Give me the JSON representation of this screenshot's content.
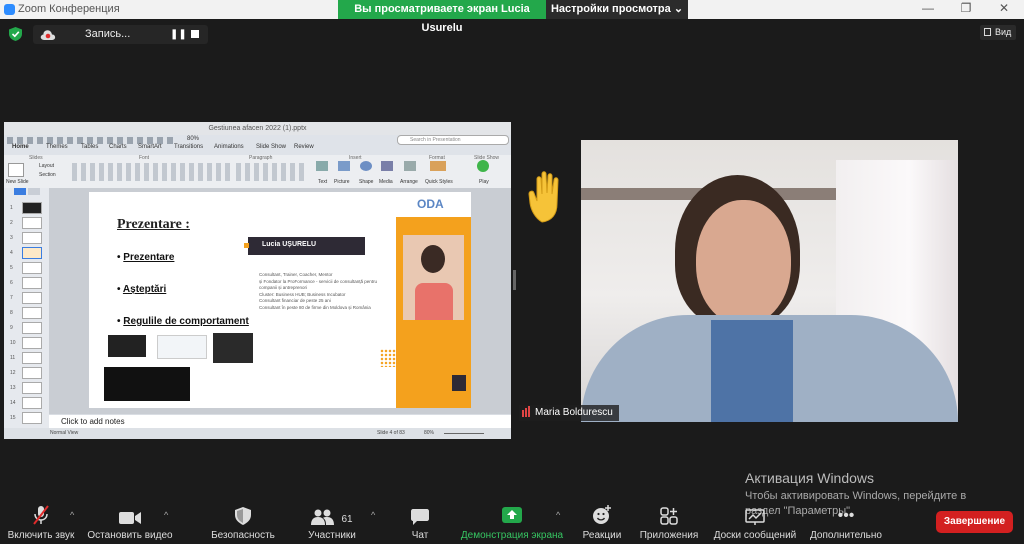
{
  "window": {
    "title": "Zoom Конференция"
  },
  "banner": {
    "sharing": "Вы просматриваете экран Lucia Usurelu",
    "view_options": "Настройки просмотра"
  },
  "recording": {
    "label": "Запись..."
  },
  "view_button": {
    "label": "Вид"
  },
  "presentation": {
    "file_title": "Gestiunea afacen 2022 (1).pptx",
    "search_placeholder": "Search in Presentation",
    "zoom_level": "80%",
    "tabs": [
      "Home",
      "Themes",
      "Tables",
      "Charts",
      "SmartArt",
      "Transitions",
      "Animations",
      "Slide Show",
      "Review"
    ],
    "ribbon_groups": [
      "Slides",
      "Font",
      "Paragraph",
      "Insert",
      "Format",
      "Slide Show"
    ],
    "ribbon_labels": [
      "New Slide",
      "Layout",
      "Section",
      "Text",
      "Picture",
      "Shape",
      "Media",
      "Arrange",
      "Quick Styles",
      "Play"
    ],
    "notes_placeholder": "Click to add notes",
    "status_view": "Normal View",
    "slide_counter": "Slide 4 of 83",
    "status_zoom": "80%",
    "slide_numbers": [
      "1",
      "2",
      "3",
      "4",
      "5",
      "6",
      "7",
      "8",
      "9",
      "10",
      "11",
      "12",
      "13",
      "14",
      "15",
      "16"
    ],
    "slide": {
      "heading": "Prezentare :",
      "bullets": [
        "Prezentare",
        "Așteptări",
        "Regulile de comportament"
      ],
      "logo": "ODA",
      "name_banner": "Lucia UȘURELU",
      "bio": [
        "Consultant, Trainer, Coacher, Mentor",
        "și Fondator la ProFormance - servicii de consultanță pentru companii și antreprenori",
        "Cluster: Business HUB; Business Incubator",
        "Consultant financiar de peste 25 ani",
        "Consultant în peste 80 de firme din Moldova și România"
      ]
    }
  },
  "participant": {
    "name": "Maria Boldurescu"
  },
  "watermark": {
    "title": "Активация Windows",
    "line1": "Чтобы активировать Windows, перейдите в",
    "line2": "раздел \"Параметры\"."
  },
  "toolbar": {
    "unmute": "Включить звук",
    "start_video": "Остановить видео",
    "security": "Безопасность",
    "participants": "Участники",
    "participants_count": "61",
    "chat": "Чат",
    "share_screen": "Демонстрация экрана",
    "reactions": "Реакции",
    "apps": "Приложения",
    "whiteboards": "Доски сообщений",
    "more": "Дополнительно",
    "end": "Завершение"
  },
  "colors": {
    "share_green": "#23a84b",
    "end_red": "#d32020",
    "slide_accent": "#f4a11d",
    "banner_dark": "#2e2a35"
  }
}
